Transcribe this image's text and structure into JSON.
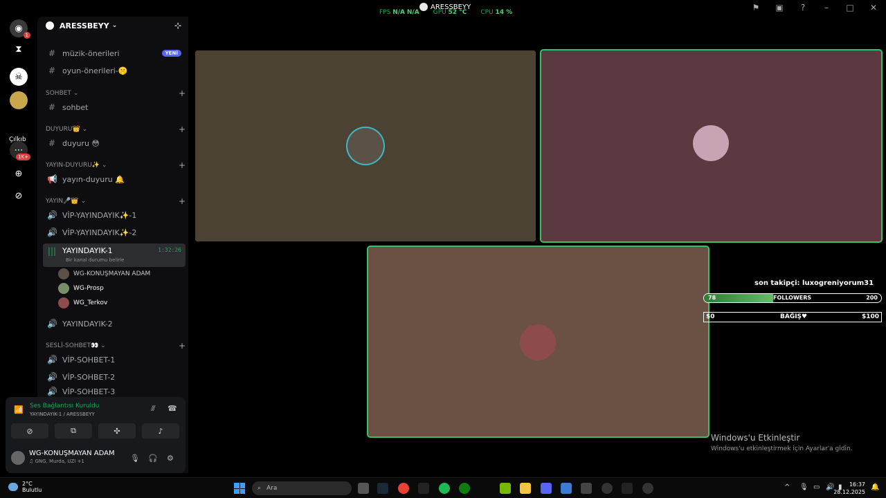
{
  "overlay": {
    "app_title": "ARESSBEYY",
    "fps_label": "FPS",
    "fps_value": "N/A",
    "fps_value2": "N/A",
    "gpu_label": "GPU",
    "gpu_value": "52 °C",
    "cpu_label": "CPU",
    "cpu_value": "14 %"
  },
  "rail": {
    "badges": {
      "discord": "1",
      "server": "1K+"
    },
    "label": "Çılkıb"
  },
  "server": {
    "name": "ARESSBEYY",
    "channels_top": [
      {
        "name": "müzik-önerileri",
        "tag": "YENİ"
      },
      {
        "name": "oyun-önerileri-🤫"
      }
    ],
    "categories": {
      "sohbet": "SOHBET",
      "duyuru": "DUYURU👑",
      "yayin_duyuru": "YAYIN-DUYURU✨",
      "yayin": "YAYIN🎤👑",
      "sesli_sohbet": "SESLİ-SOHBET👀"
    },
    "ch_sohbet": "sohbet",
    "ch_duyuru": "duyuru 😳",
    "ch_yayin_duyuru": "yayın-duyuru 🔔",
    "ch_vip1": "VİP-YAYINDAYIK✨-1",
    "ch_vip2": "VİP-YAYINDAYIK✨-2",
    "active_channel": {
      "name": "YAYINDAYIK-1",
      "status": "Bir kanal durumu belirle",
      "time": "1:32:26"
    },
    "voice_users": [
      "WG-KONUŞMAYAN ADAM",
      "WG-Prosp",
      "WG_Terkov"
    ],
    "ch_yayin2": "YAYINDAYIK-2",
    "ch_sohbet1": "VİP-SOHBET-1",
    "ch_sohbet2": "VİP-SOHBET-2",
    "ch_sohbet3": "VİP-SOHBET-3"
  },
  "voice_panel": {
    "status": "Ses Bağlantısı Kuruldu",
    "sub": "YAYINDAYIK-1 / ARESSBEYY",
    "user": "WG-KONUŞMAYAN ADAM",
    "user_sub": "♫ GNG, Murda, UZI +1"
  },
  "tiles": {
    "colors": {
      "t1": "#4c4233",
      "t2": "#5a3a40",
      "t3": "#6b5144"
    }
  },
  "widget": {
    "follower_text": "son takipçi: luxogreniyorum31",
    "followers_current": "78",
    "followers_label": "FOLLOWERS",
    "followers_goal": "200",
    "followers_fraction": 0.39,
    "donation_min": "$0",
    "donation_label": "BAĞIŞ♥",
    "donation_max": "$100"
  },
  "activation": {
    "title": "Windows'u Etkinleştir",
    "sub": "Windows'u etkinleştirmek için Ayarlar'a gidin."
  },
  "taskbar": {
    "temp": "2°C",
    "weather": "Bulutlu",
    "search_placeholder": "Ara",
    "time": "16:37",
    "date": "28.12.2025"
  }
}
